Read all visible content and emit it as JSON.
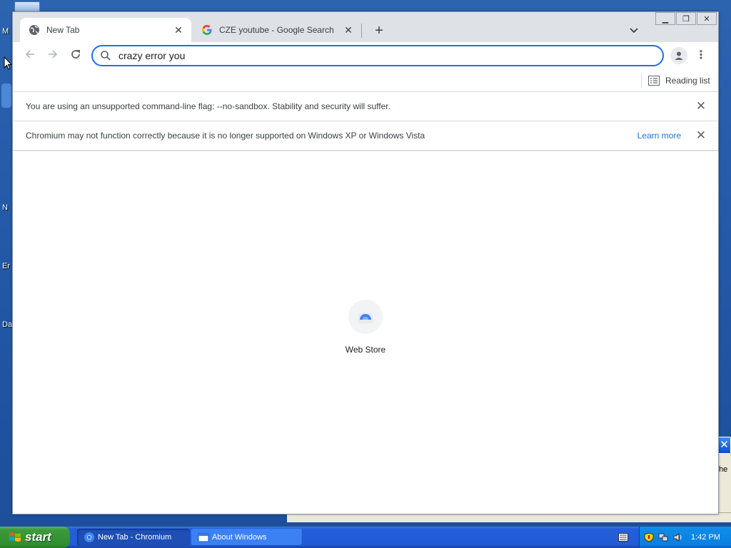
{
  "desktop": {
    "labels": [
      "M",
      "N",
      "Er",
      "Da"
    ]
  },
  "about_window": {
    "close_symbol": "✕",
    "partial_text": "he"
  },
  "window_controls": {
    "minimize": "▁",
    "restore": "❐",
    "close": "✕"
  },
  "tabs": [
    {
      "title": "New Tab",
      "icon": "globe-icon",
      "active": true
    },
    {
      "title": "CZE youtube - Google Search",
      "icon": "google-g-icon",
      "active": false
    }
  ],
  "tabstrip": {
    "new_tab_symbol": "+",
    "tab_search_symbol": "⌄",
    "close_symbol": "✕"
  },
  "toolbar": {
    "back_symbol": "←",
    "forward_symbol": "→",
    "reload_symbol": "↻",
    "omnibox_value": "crazy error you",
    "menu_symbol": "⋮"
  },
  "bookmarks_bar": {
    "reading_list_label": "Reading list"
  },
  "infobars": [
    {
      "message": "You are using an unsupported command-line flag: --no-sandbox. Stability and security will suffer.",
      "link": ""
    },
    {
      "message": "Chromium may not function correctly because it is no longer supported on Windows XP or Windows Vista",
      "link": "Learn more"
    }
  ],
  "new_tab_page": {
    "shortcuts": [
      {
        "label": "Web Store",
        "icon": "web-store-icon"
      }
    ]
  },
  "taskbar": {
    "start_label": "start",
    "items": [
      {
        "label": "New Tab - Chromium",
        "icon": "chromium-icon",
        "active": true
      },
      {
        "label": "About Windows",
        "icon": "window-icon",
        "active": false
      }
    ],
    "clock": "1:42 PM"
  },
  "colors": {
    "accent": "#1a73e8",
    "tabstrip_bg": "#dee1e6",
    "taskbar_blue": "#245edb",
    "start_green": "#3c9a3c"
  }
}
